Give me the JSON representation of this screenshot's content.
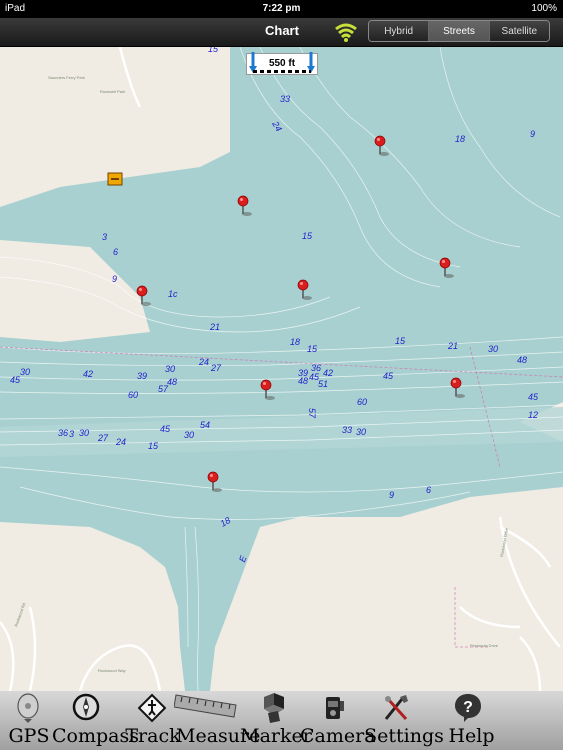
{
  "status_bar": {
    "device": "iPad",
    "time": "7:22 pm",
    "battery": "100%"
  },
  "nav": {
    "title": "Chart",
    "map_types": [
      "Hybrid",
      "Streets",
      "Satellite"
    ],
    "selected_map_type": "Streets"
  },
  "scale": {
    "label": "550 ft"
  },
  "place_labels": [
    "Saunders Ferry Park",
    "Rockwell Park",
    "Peninsula Drive",
    "Rockwood Rd",
    "Rockwood Way",
    "Rockwood Drive"
  ],
  "depth_labels": [
    "15",
    "33",
    "24",
    "18",
    "9",
    "3",
    "6",
    "15",
    "9",
    "1c",
    "21",
    "18",
    "15",
    "15",
    "21",
    "30",
    "48",
    "45",
    "30",
    "42",
    "39",
    "48",
    "57",
    "30",
    "24",
    "27",
    "39",
    "36",
    "42",
    "48",
    "45",
    "51",
    "45",
    "45",
    "12",
    "60",
    "60",
    "54",
    "45",
    "30",
    "57",
    "33",
    "30",
    "15",
    "24",
    "27",
    "30",
    "36",
    "3",
    "18",
    "9",
    "6",
    "E"
  ],
  "markers_count": 9,
  "toolbar": [
    {
      "label": "GPS",
      "icon": "gps-icon"
    },
    {
      "label": "Compass",
      "icon": "compass-icon"
    },
    {
      "label": "Track",
      "icon": "track-icon"
    },
    {
      "label": "Measure",
      "icon": "ruler-icon"
    },
    {
      "label": "Marker",
      "icon": "marker-icon"
    },
    {
      "label": "Camera",
      "icon": "camera-icon"
    },
    {
      "label": "Settings",
      "icon": "settings-icon"
    },
    {
      "label": "Help",
      "icon": "help-icon"
    }
  ]
}
